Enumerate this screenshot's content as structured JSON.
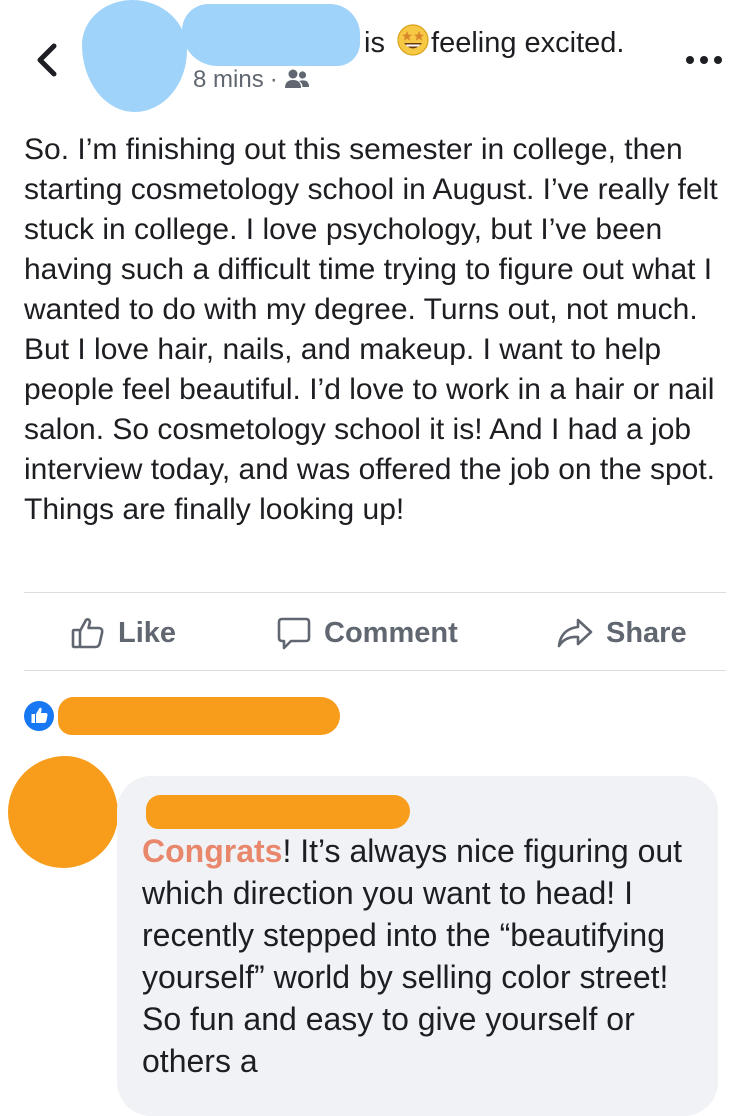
{
  "header": {
    "status_verb": "is",
    "feeling": "feeling excited.",
    "emoji_icon": "star-struck-emoji",
    "timestamp": "8 mins",
    "separator": "·",
    "audience_icon": "friends-icon",
    "back_icon": "chevron-left-icon",
    "more_icon": "more-options-icon"
  },
  "post": {
    "text": "So. I’m finishing out this semester in college, then starting cosmetology school in August. I’ve really felt stuck in college. I love psychology, but I’ve been having such a difficult time trying to figure out what I wanted to do with my degree. Turns out, not much. But I love hair, nails, and makeup. I want to help people feel beautiful. I’d love to work in a hair or nail salon. So cosmetology school it is! And I had a job interview today, and was offered the job on the spot. Things are finally looking up!"
  },
  "actions": {
    "like": "Like",
    "comment": "Comment",
    "share": "Share"
  },
  "reactions": {
    "icon": "like-badge-icon"
  },
  "comment": {
    "highlight": "Congrats",
    "text": "! It’s always nice figuring out which direction you want to head! I recently stepped into the “beautifying yourself” world by selling color street! So fun and easy to give yourself or others a"
  },
  "colors": {
    "redaction_blue": "#9fd3f9",
    "redaction_orange": "#f89c1b",
    "like_blue": "#1877f2",
    "highlight": "#e9876c",
    "secondary_text": "#606770",
    "bubble": "#f0f2f5"
  }
}
